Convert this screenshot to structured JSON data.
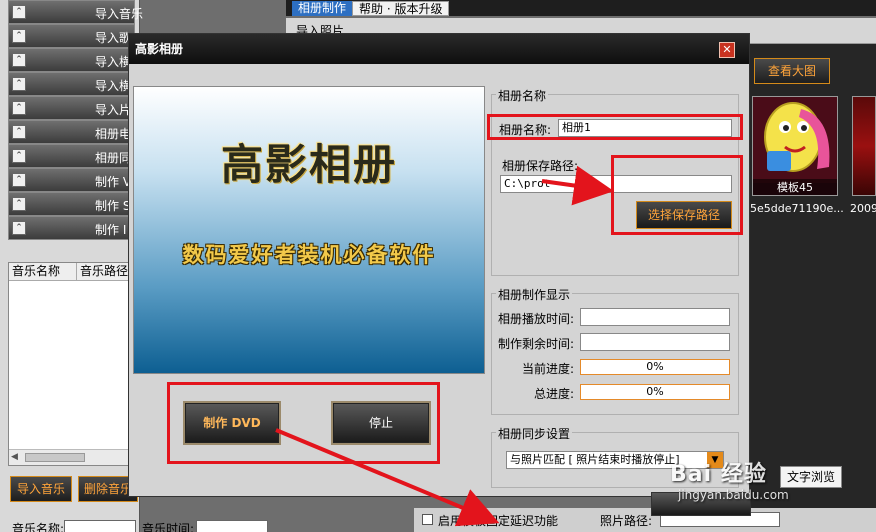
{
  "app": {
    "top_tabs": [
      "相册制作",
      "帮助 · 版本升级"
    ],
    "header_label": "导入照片",
    "left_accordion": [
      "导入音乐",
      "导入歌",
      "导入横",
      "导入横",
      "导入片",
      "相册电",
      "相册同",
      "制作 V",
      "制作 S",
      "制作 I"
    ],
    "music_columns": [
      "音乐名称",
      "音乐路径"
    ],
    "music_buttons": [
      "导入音乐",
      "删除音乐"
    ],
    "bottom_labels": [
      "音乐名称:",
      "音乐时间:"
    ],
    "view_large_button": "查看大图",
    "thumbnails": [
      {
        "caption": "模板45",
        "name": "5e5dde71190e..."
      },
      {
        "caption": "",
        "name": "2009"
      }
    ],
    "text_browse_label": "文字浏览",
    "bottom_checkbox_label": "启用模板固定延迟功能",
    "photo_path_label": "照片路径:"
  },
  "dialog": {
    "title": "高影相册",
    "close_label": "✕",
    "banner_title": "高影相册",
    "banner_subtitle": "数码爱好者装机必备软件",
    "make_dvd_button": "制作 DVD",
    "stop_button": "停止",
    "album_name_group": {
      "title": "相册名称",
      "name_label": "相册名称:",
      "name_value": "相册1",
      "path_label": "相册保存路径:",
      "path_value": "C:\\prot",
      "choose_path_button": "选择保存路径"
    },
    "progress_group": {
      "title": "相册制作显示",
      "play_time_label": "相册播放时间:",
      "remaining_time_label": "制作剩余时间:",
      "current_progress_label": "当前进度:",
      "current_progress_value": "0%",
      "total_progress_label": "总进度:",
      "total_progress_value": "0%"
    },
    "sync_group": {
      "title": "相册同步设置",
      "selected": "与照片匹配 [ 照片结束时播放停止]"
    }
  },
  "watermark": {
    "logo": "Bai 经验",
    "url": "jingyan.baidu.com"
  },
  "colors": {
    "accent_orange": "#ffa43a",
    "annotation_red": "#e3141c",
    "title_bar": "#0e0e0e"
  }
}
